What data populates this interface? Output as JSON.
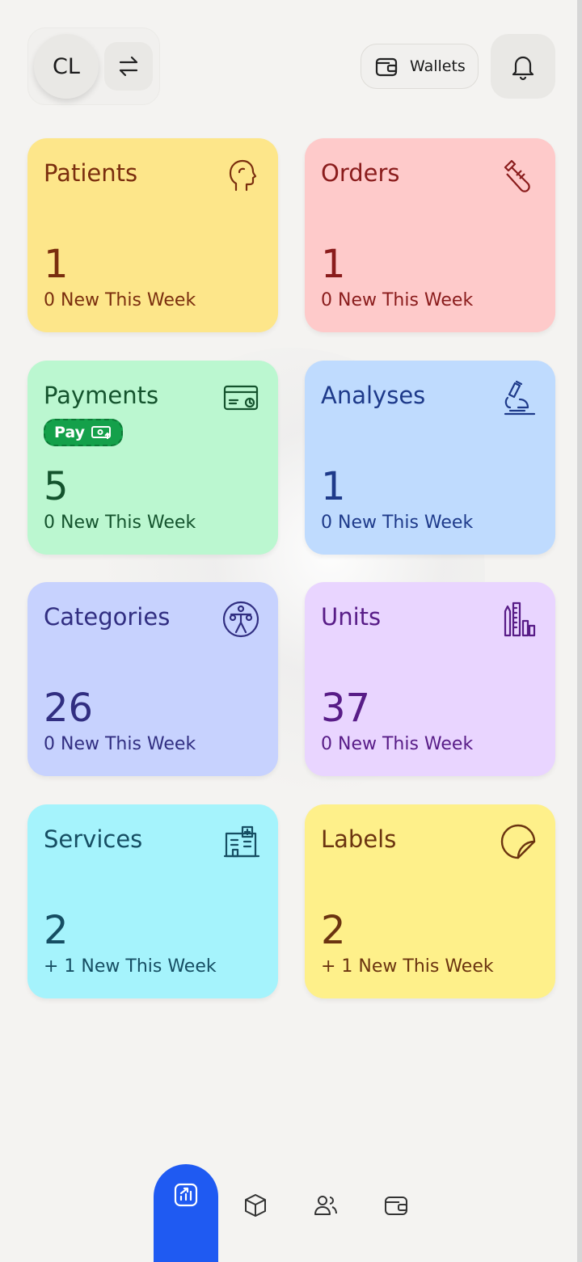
{
  "header": {
    "avatar_initials": "CL",
    "wallets_label": "Wallets"
  },
  "cards": [
    {
      "title": "Patients",
      "count": "1",
      "sub": "0 New This Week",
      "bg": "#fde68a",
      "fg": "#7a2e0e",
      "icon": "head-profile-icon"
    },
    {
      "title": "Orders",
      "count": "1",
      "sub": "0 New This Week",
      "bg": "#fecaca",
      "fg": "#8a1c1c",
      "icon": "test-tube-icon"
    },
    {
      "title": "Payments",
      "count": "5",
      "sub": "0 New This Week",
      "bg": "#bbf7d0",
      "fg": "#14532d",
      "icon": "card-clock-icon",
      "badge": "Pay"
    },
    {
      "title": "Analyses",
      "count": "1",
      "sub": "0 New This Week",
      "bg": "#bfdbfe",
      "fg": "#1e3a8a",
      "icon": "microscope-icon"
    },
    {
      "title": "Categories",
      "count": "26",
      "sub": "0 New This Week",
      "bg": "#c7d2fe",
      "fg": "#312e81",
      "icon": "body-anatomy-icon"
    },
    {
      "title": "Units",
      "count": "37",
      "sub": "0 New This Week",
      "bg": "#e9d5ff",
      "fg": "#581c87",
      "icon": "ruler-chart-icon"
    },
    {
      "title": "Services",
      "count": "2",
      "sub": "+ 1 New This Week",
      "bg": "#a5f3fc",
      "fg": "#164e63",
      "icon": "hospital-icon"
    },
    {
      "title": "Labels",
      "count": "2",
      "sub": "+ 1 New This Week",
      "bg": "#fef08a",
      "fg": "#6b3410",
      "icon": "sticker-icon"
    }
  ],
  "nav": {
    "items": [
      "dashboard-icon",
      "package-icon",
      "users-icon",
      "wallet-icon"
    ],
    "active": "dashboard-icon",
    "accent": "#1f5af2"
  }
}
